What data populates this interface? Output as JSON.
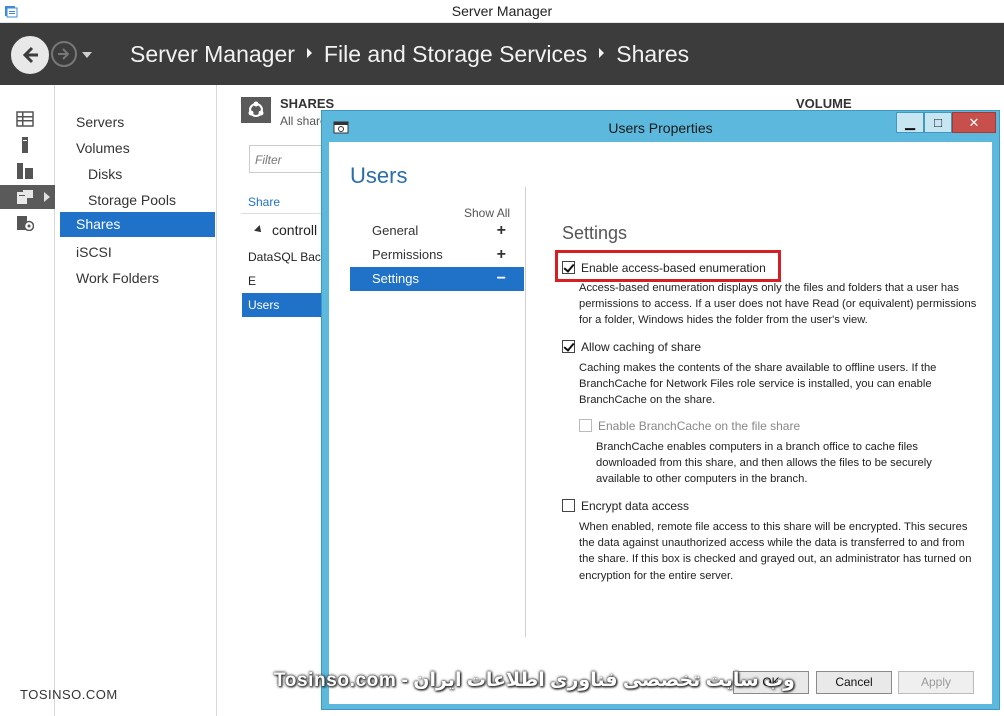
{
  "window": {
    "title": "Server Manager"
  },
  "header": {
    "breadcrumb": [
      "Server Manager",
      "File and Storage Services",
      "Shares"
    ]
  },
  "nav": {
    "items": [
      {
        "label": "Servers"
      },
      {
        "label": "Volumes"
      },
      {
        "label": "Disks"
      },
      {
        "label": "Storage Pools"
      },
      {
        "label": "Shares"
      },
      {
        "label": "iSCSI"
      },
      {
        "label": "Work Folders"
      }
    ]
  },
  "shares": {
    "title": "SHARES",
    "subtitle": "All shares",
    "filter_placeholder": "Filter",
    "column_header": "Share",
    "group_label": "controll",
    "rows": [
      "DataSQL Back",
      "E",
      "Users"
    ]
  },
  "volume": {
    "title": "VOLUME"
  },
  "dialog": {
    "title": "Users Properties",
    "heading": "Users",
    "show_all": "Show All",
    "nav": [
      {
        "label": "General",
        "sign": "+"
      },
      {
        "label": "Permissions",
        "sign": "+"
      },
      {
        "label": "Settings",
        "sign": "−"
      }
    ],
    "settings_title": "Settings",
    "options": {
      "abe": {
        "label": "Enable access-based enumeration",
        "checked": true,
        "desc": "Access-based enumeration displays only the files and folders that a user has permissions to access. If a user does not have Read (or equivalent) permissions for a folder, Windows hides the folder from the user's view."
      },
      "caching": {
        "label": "Allow caching of share",
        "checked": true,
        "desc": "Caching makes the contents of the share available to offline users. If the BranchCache for Network Files role service is installed, you can enable BranchCache on the share."
      },
      "branchcache": {
        "label": "Enable BranchCache on the file share",
        "checked": false,
        "disabled": true,
        "desc": "BranchCache enables computers in a branch office to cache files downloaded from this share, and then allows the files to be securely available to other computers in the branch."
      },
      "encrypt": {
        "label": "Encrypt data access",
        "checked": false,
        "desc": "When enabled, remote file access to this share will be encrypted. This secures the data against unauthorized access while the data is transferred to and from the share. If this box is checked and grayed out, an administrator has turned on encryption for the entire server."
      }
    },
    "buttons": {
      "ok": "OK",
      "cancel": "Cancel",
      "apply": "Apply"
    }
  },
  "watermark": {
    "left": "TOSINSO.COM",
    "center": "وب سایت تخصصی فناوری اطلاعات ایران - Tosinso.com"
  },
  "colors": {
    "accent": "#1f72c7",
    "header_bg": "#3c3c3c",
    "dialog_frame": "#5cb8dc",
    "highlight_box": "#d61f25",
    "heading_blue": "#2a6ea8"
  }
}
